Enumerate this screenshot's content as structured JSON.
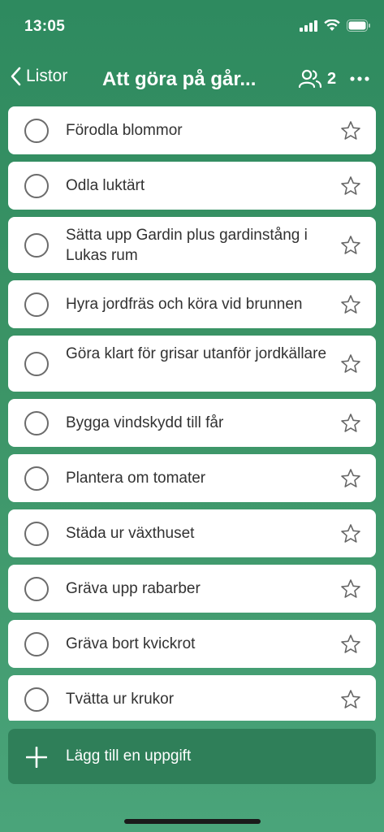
{
  "status": {
    "time": "13:05",
    "icons": [
      "signal-icon",
      "wifi-icon",
      "battery-icon"
    ]
  },
  "nav": {
    "back_label": "Listor",
    "title": "Att göra på går...",
    "shared_count": "2",
    "icons": {
      "back": "chevron-left-icon",
      "people": "people-icon",
      "more": "more-horizontal-icon"
    }
  },
  "tasks": [
    {
      "text": "Förodla blommor"
    },
    {
      "text": "Odla luktärt"
    },
    {
      "text": "Sätta upp Gardin plus gardinstång i Lukas rum"
    },
    {
      "text": "Hyra jordfräs och köra vid brunnen"
    },
    {
      "text": "Göra klart för grisar utanför jordkällare"
    },
    {
      "text": "Bygga vindskydd till får"
    },
    {
      "text": "Plantera om tomater"
    },
    {
      "text": "Städa ur växthuset"
    },
    {
      "text": "Gräva upp rabarber"
    },
    {
      "text": "Gräva bort kvickrot"
    },
    {
      "text": "Tvätta ur krukor"
    }
  ],
  "add_task": {
    "label": "Lägg till en uppgift",
    "icon": "plus-icon"
  },
  "colors": {
    "accent": "#2e8a5f",
    "card": "#ffffff",
    "add_bar": "#2f7f59"
  }
}
